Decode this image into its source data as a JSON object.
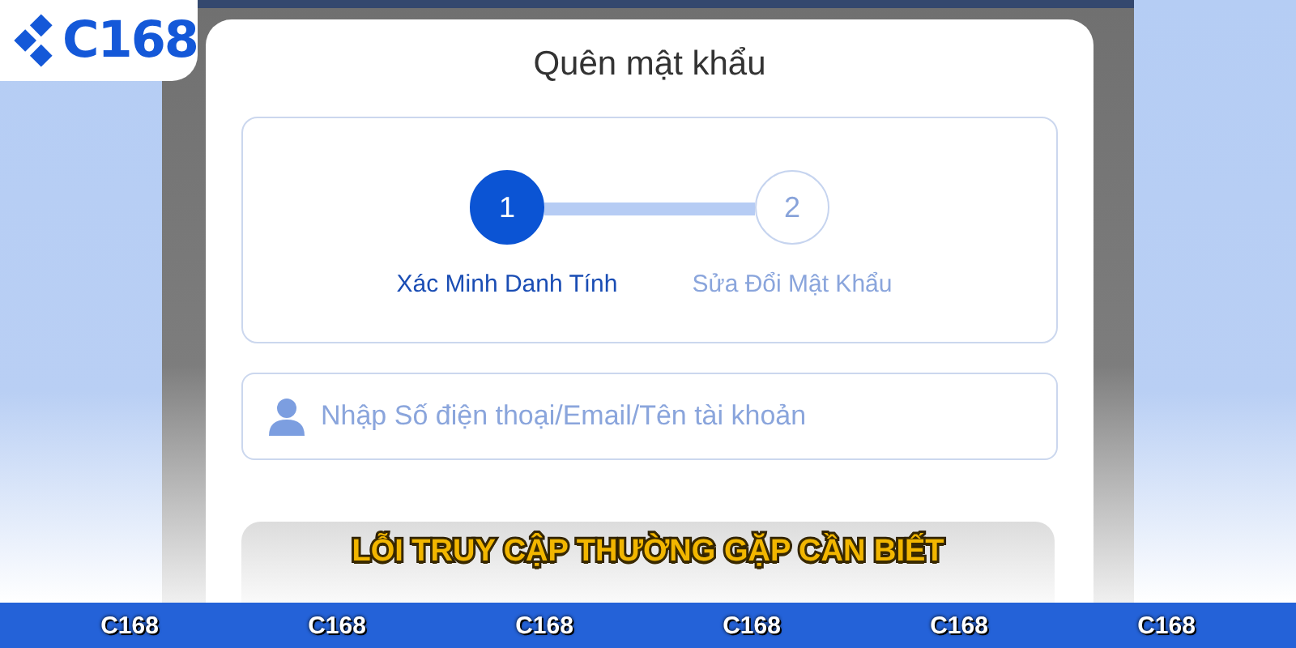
{
  "logo": {
    "text": "C168"
  },
  "dialog": {
    "title": "Quên mật khẩu",
    "steps": [
      {
        "number": "1",
        "label": "Xác Minh Danh Tính",
        "selected": true
      },
      {
        "number": "2",
        "label": "Sửa Đổi Mật Khẩu",
        "selected": false
      }
    ],
    "account_field": {
      "placeholder": "Nhập Số điện thoại/Email/Tên tài khoản"
    }
  },
  "caption": "LỖI TRUY CẬP THƯỜNG GẶP CẦN BIẾT",
  "footer_band": [
    "C168",
    "C168",
    "C168",
    "C168",
    "C168",
    "C168"
  ]
}
